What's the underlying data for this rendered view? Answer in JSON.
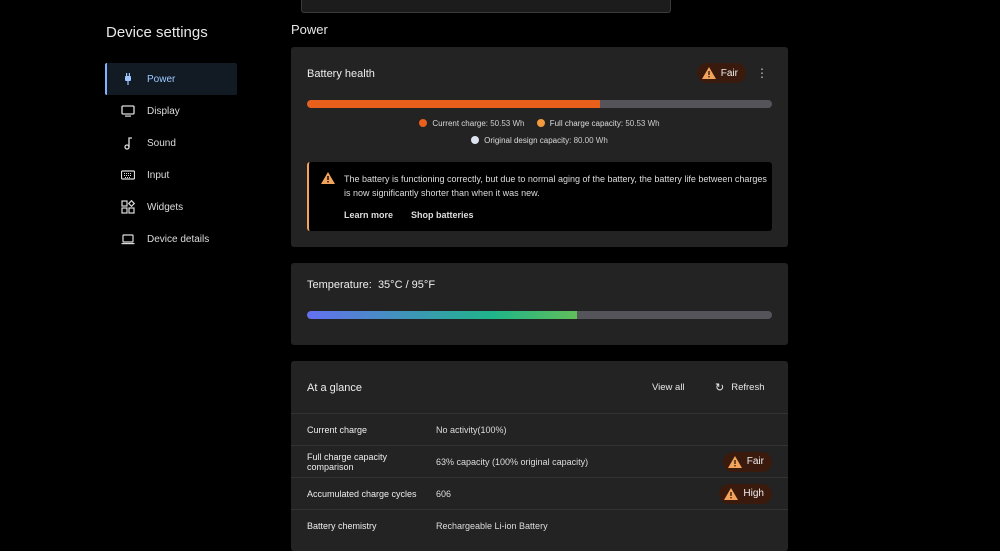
{
  "sidebar": {
    "title": "Device settings",
    "items": [
      {
        "label": "Power",
        "icon": "plug-icon",
        "active": true
      },
      {
        "label": "Display"
      },
      {
        "label": "Sound"
      },
      {
        "label": "Input"
      },
      {
        "label": "Widgets"
      },
      {
        "label": "Device details"
      }
    ]
  },
  "main": {
    "heading": "Power",
    "battery_health": {
      "title": "Battery health",
      "status": "Fair",
      "charge_percent": 63,
      "legend": {
        "current_label": "Current charge:",
        "current_value": "50.53 Wh",
        "full_label": "Full charge capacity:",
        "full_value": "50.53 Wh",
        "design_label": "Original design capacity:",
        "design_value": "80.00 Wh"
      },
      "alert": {
        "text": "The battery is functioning correctly, but due to normal aging of the battery, the battery life between charges is now significantly shorter than when it was new.",
        "learn_more": "Learn more",
        "shop": "Shop batteries"
      }
    },
    "temperature": {
      "label": "Temperature:",
      "value": "35°C / 95°F",
      "level_percent": 58
    },
    "glance": {
      "title": "At a glance",
      "view_all": "View all",
      "refresh": "Refresh",
      "rows": [
        {
          "label": "Current charge",
          "value": "No activity(100%)"
        },
        {
          "label": "Full charge capacity comparison",
          "value": "63% capacity (100% original capacity)",
          "badge": "Fair"
        },
        {
          "label": "Accumulated charge cycles",
          "value": "606",
          "badge": "High"
        },
        {
          "label": "Battery chemistry",
          "value": "Rechargeable Li-ion Battery"
        }
      ]
    }
  },
  "colors": {
    "accent": "#7fb3ff",
    "orange": "#e8601c",
    "warn": "#f3a45c"
  }
}
